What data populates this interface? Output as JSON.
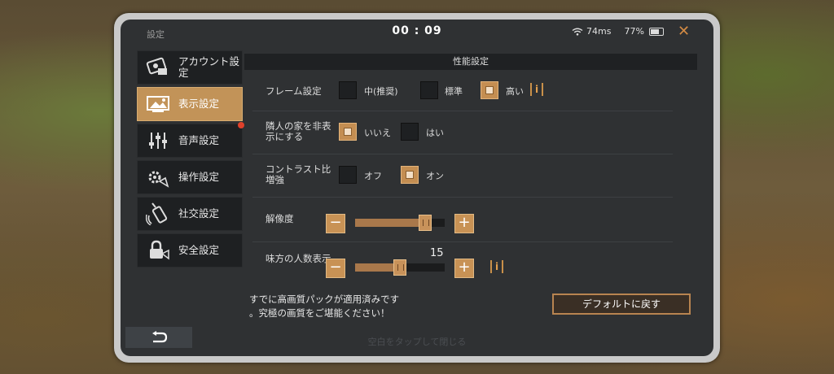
{
  "window": {
    "title": "設定",
    "time": "00 : 09",
    "ping": "74ms",
    "battery": "77%"
  },
  "sidebar": {
    "items": [
      {
        "label": "アカウント設定",
        "icon": "account-icon",
        "active": false
      },
      {
        "label": "表示設定",
        "icon": "display-icon",
        "active": true
      },
      {
        "label": "音声設定",
        "icon": "audio-sliders-icon",
        "active": false,
        "badge": true
      },
      {
        "label": "操作設定",
        "icon": "controls-gear-icon",
        "active": false
      },
      {
        "label": "社交設定",
        "icon": "walkie-talkie-icon",
        "active": false
      },
      {
        "label": "安全設定",
        "icon": "lock-icon",
        "active": false
      }
    ]
  },
  "content": {
    "section_title": "性能設定",
    "frame": {
      "label": "フレーム設定",
      "options": [
        "中(推奨)",
        "標準",
        "高い"
      ],
      "selected": "高い"
    },
    "hide_neighbor": {
      "label": "隣人の家を非表示にする",
      "options": [
        "いいえ",
        "はい"
      ],
      "selected": "いいえ"
    },
    "contrast": {
      "label": "コントラスト比増強",
      "options": [
        "オフ",
        "オン"
      ],
      "selected": "オン"
    },
    "resolution": {
      "label": "解像度",
      "value_fraction": 0.78
    },
    "team_count": {
      "label": "味方の人数表示",
      "value": "15",
      "value_fraction": 0.5
    },
    "info_glyph": "i",
    "minus": "−",
    "plus": "+"
  },
  "notice": {
    "line1": "すでに高画質パックが適用済みです",
    "line2": "。究極の画質をご堪能ください！"
  },
  "default_button": "デフォルトに戻す",
  "tap_hint": "空白をタップして閉じる",
  "colors": {
    "accent": "#c48e52",
    "panel": "#2f3133",
    "close": "#d28a44"
  }
}
